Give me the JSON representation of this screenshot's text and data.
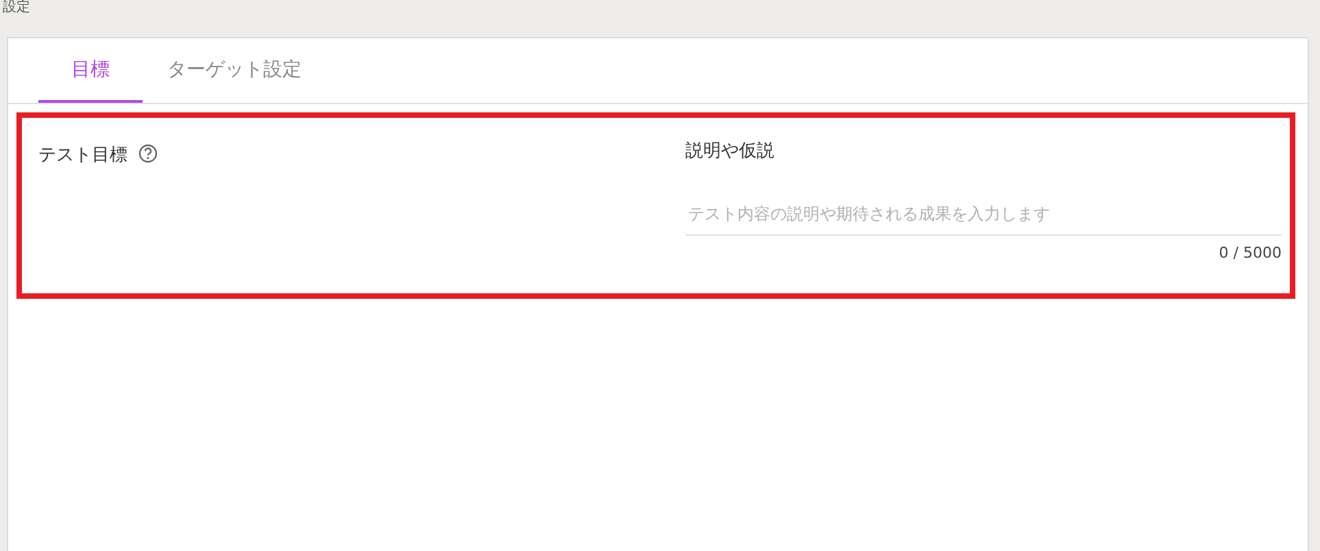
{
  "window": {
    "title": "設定"
  },
  "tabs": [
    {
      "label": "目標",
      "selected": true
    },
    {
      "label": "ターゲット設定",
      "selected": false
    }
  ],
  "goal": {
    "label": "テスト目標",
    "description_label": "説明や仮説",
    "placeholder": "テスト内容の説明や期待される成果を入力します",
    "counter": "0 / 5000"
  }
}
